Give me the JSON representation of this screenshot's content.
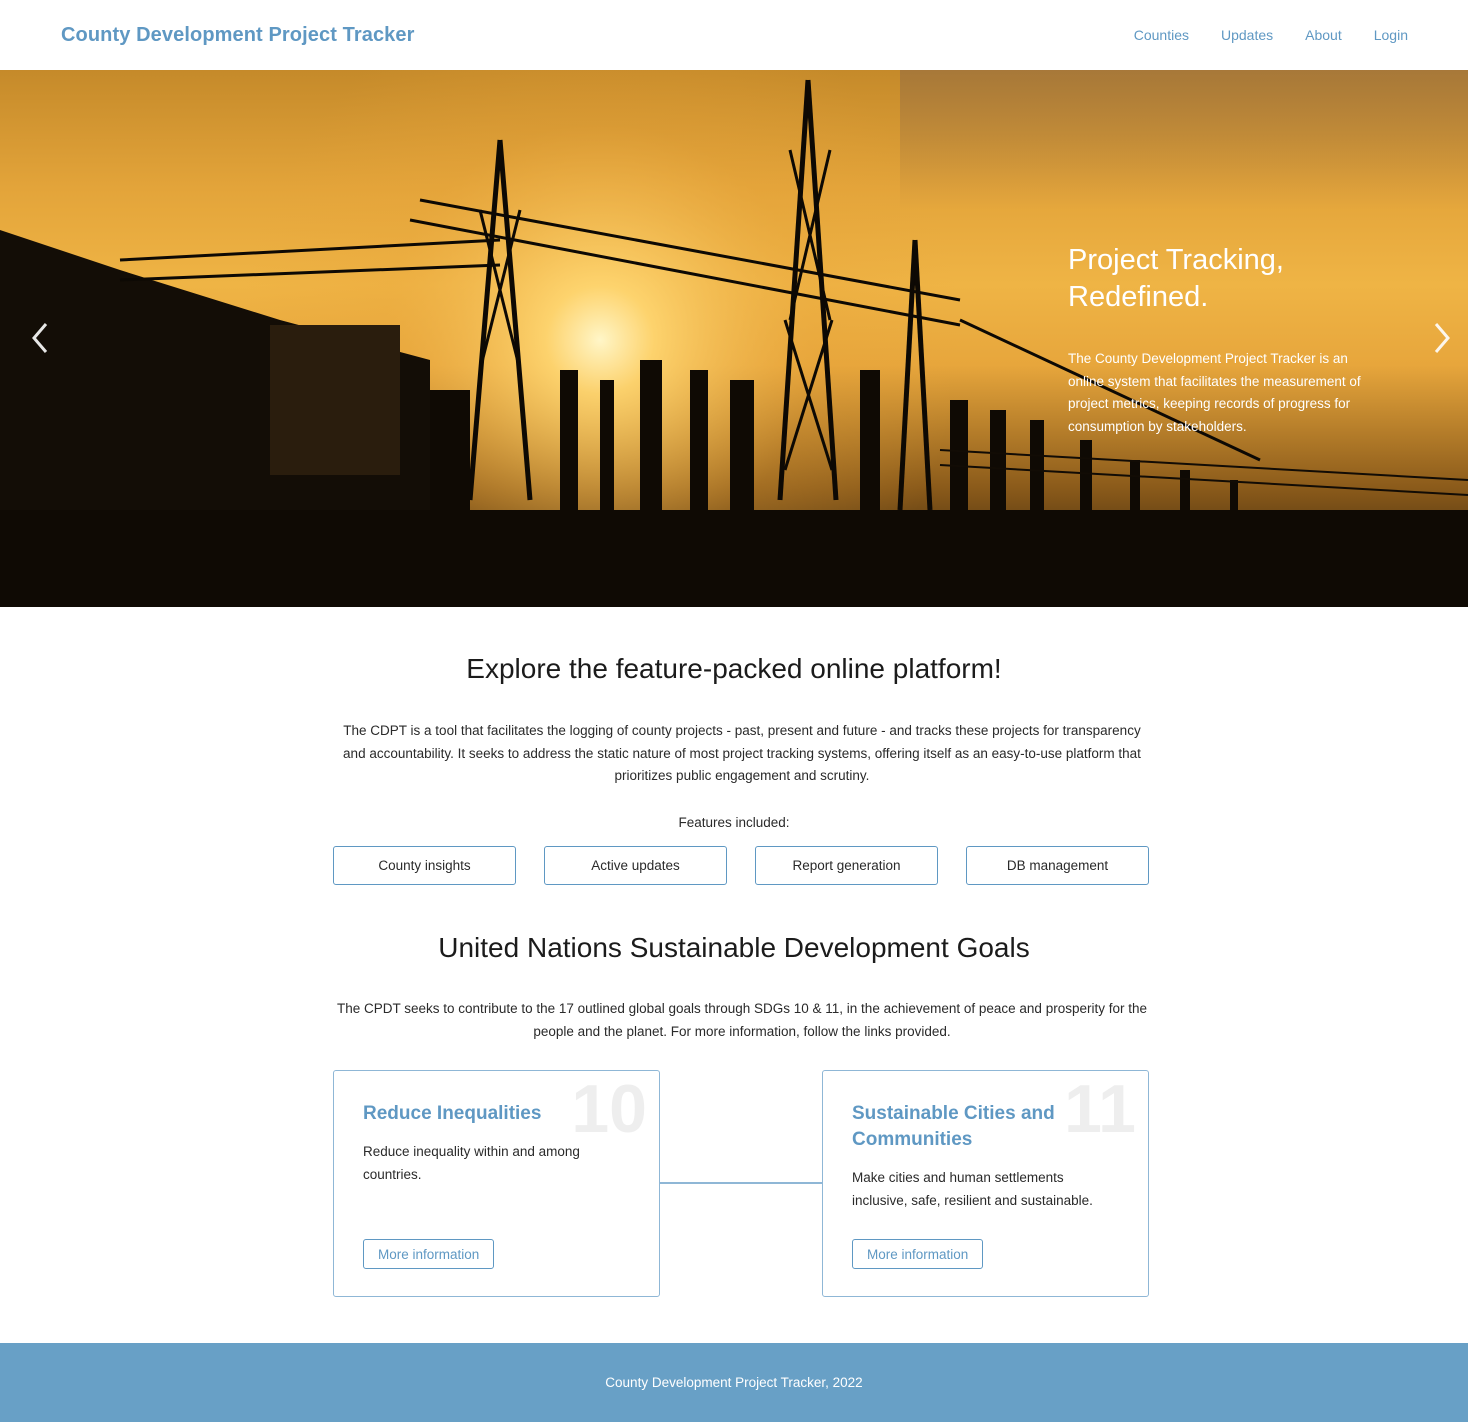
{
  "nav": {
    "brand": "County Development Project Tracker",
    "links": [
      "Counties",
      "Updates",
      "About",
      "Login"
    ]
  },
  "hero": {
    "title_line1": "Project Tracking,",
    "title_line2": "Redefined.",
    "text": "The County Development Project Tracker is an online system that facilitates the measurement of project metrics, keeping records of progress for consumption by stakeholders.",
    "prev_icon": "chevron-left-icon",
    "next_icon": "chevron-right-icon"
  },
  "explore": {
    "title": "Explore the feature-packed online platform!",
    "text": "The CDPT is a tool that facilitates the logging of county projects - past, present and future - and tracks these projects for transparency and accountability. It seeks to address the static nature of most project tracking systems, offering itself as an easy-to-use platform that prioritizes public engagement and scrutiny.",
    "features_label": "Features included:",
    "features": [
      "County insights",
      "Active updates",
      "Report generation",
      "DB management"
    ]
  },
  "sdg": {
    "title": "United Nations Sustainable Development Goals",
    "text": "The CPDT seeks to contribute to the 17 outlined global goals through SDGs 10 & 11, in the achievement of peace and prosperity for the people and the planet. For more information, follow the links provided.",
    "cards": [
      {
        "number": "10",
        "title": "Reduce Inequalities",
        "desc": "Reduce inequality within and among countries.",
        "link": "More information"
      },
      {
        "number": "11",
        "title": "Sustainable Cities and Communities",
        "desc": "Make cities and human settlements inclusive, safe, resilient and sustainable.",
        "link": "More information"
      }
    ]
  },
  "footer": {
    "text": "County Development Project Tracker, 2022"
  },
  "colors": {
    "accent": "#5f98c3",
    "footer_bg": "#68a0c6",
    "card_border": "#8fb7d6"
  }
}
